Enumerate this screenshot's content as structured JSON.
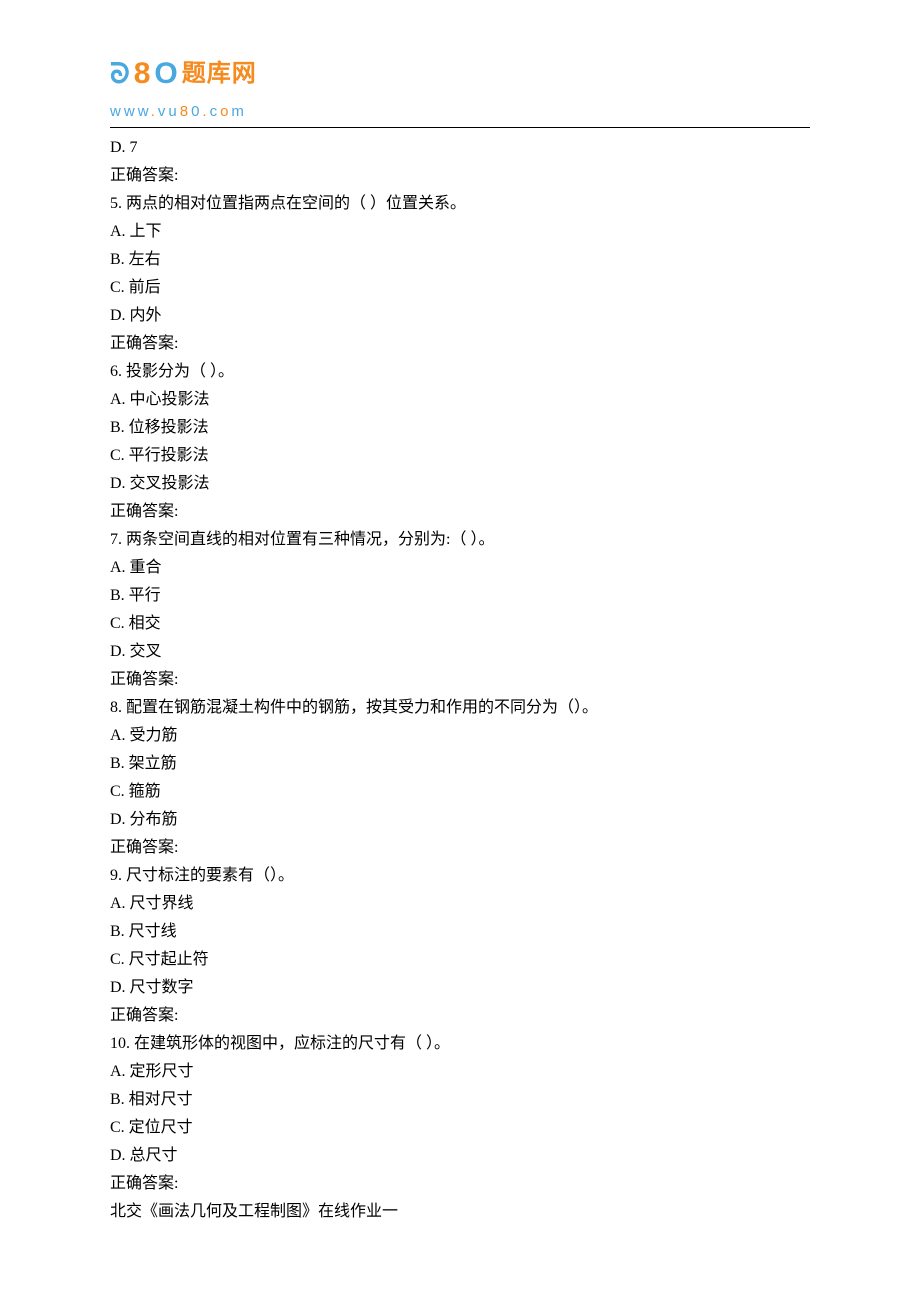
{
  "logo": {
    "cn_text": "题库网",
    "url_plain": "www.vu80.com"
  },
  "prev_q_tail": {
    "optD": "D. 7",
    "answer_label": "正确答案:"
  },
  "q5": {
    "stem": "5.   两点的相对位置指两点在空间的（  ）位置关系。",
    "A": "A.  上下",
    "B": "B.  左右",
    "C": "C.  前后",
    "D": "D.  内外",
    "answer_label": "正确答案:"
  },
  "q6": {
    "stem": "6.   投影分为（  ）。",
    "A": "A. 中心投影法",
    "B": "B. 位移投影法",
    "C": "C. 平行投影法",
    "D": "D. 交叉投影法",
    "answer_label": "正确答案:"
  },
  "q7": {
    "stem": "7.   两条空间直线的相对位置有三种情况，分别为:（  ）。",
    "A": "A.  重合",
    "B": "B.  平行",
    "C": "C.  相交",
    "D": "D.  交叉",
    "answer_label": "正确答案:"
  },
  "q8": {
    "stem": "8.   配置在钢筋混凝土构件中的钢筋，按其受力和作用的不同分为（）。",
    "A": "A.  受力筋",
    "B": "B.  架立筋",
    "C": "C.  箍筋",
    "D": "D.  分布筋",
    "answer_label": "正确答案:"
  },
  "q9": {
    "stem": "9.   尺寸标注的要素有（）。",
    "A": "A. 尺寸界线",
    "B": "B. 尺寸线",
    "C": "C. 尺寸起止符",
    "D": "D. 尺寸数字",
    "answer_label": "正确答案:"
  },
  "q10": {
    "stem": "10.   在建筑形体的视图中，应标注的尺寸有（  ）。",
    "A": "A. 定形尺寸",
    "B": "B. 相对尺寸",
    "C": "C. 定位尺寸",
    "D": "D. 总尺寸",
    "answer_label": "正确答案:"
  },
  "footer": "北交《画法几何及工程制图》在线作业一"
}
